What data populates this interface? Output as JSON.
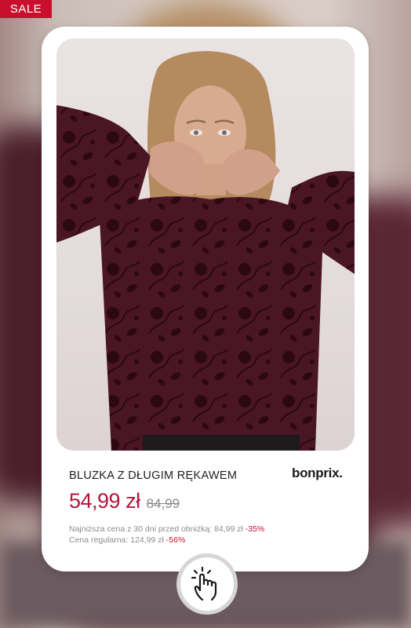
{
  "badge": {
    "label": "SALE"
  },
  "product": {
    "name": "BLUZKA Z DŁUGIM RĘKAWEM",
    "brand": "bonprix.",
    "price": "54,99 zł",
    "old_price": "84,99",
    "lowest_price_label": "Najniższa cena z 30 dni przed obniżką: 84,99 zł",
    "lowest_price_discount": "-35%",
    "regular_price_label": "Cena regularna: 124,99 zł",
    "regular_price_discount": "-56%"
  },
  "icons": {
    "tap": "tap-hand-icon"
  },
  "colors": {
    "accent": "#b3163d",
    "badge": "#c8102e",
    "garment": "#4b1626"
  }
}
